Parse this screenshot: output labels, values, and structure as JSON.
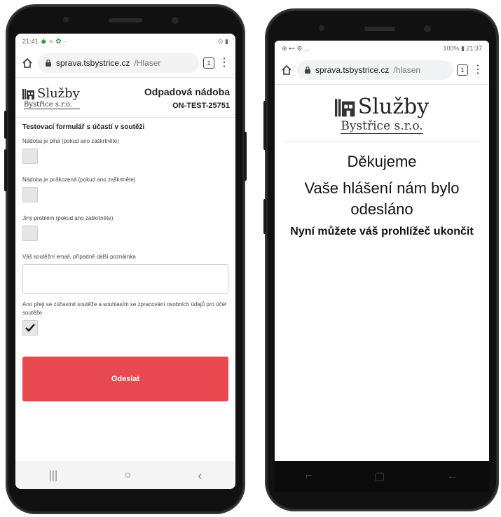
{
  "left": {
    "status": {
      "time": "21:41",
      "right_icons": "⊙ ▮"
    },
    "url": {
      "domain": "sprava.tsbystrice.cz",
      "path": "/Hlaser",
      "tab_count": "1"
    },
    "logo": {
      "name": "Služby",
      "sub": "Bystřice s.r.o."
    },
    "header": {
      "title": "Odpadová nádoba",
      "code": "ON-TEST-25751"
    },
    "form": {
      "title": "Testovací formulář s účastí v soutěži",
      "fields": [
        {
          "label": "Nádoba je plná (pokud ano zaškrtněte)"
        },
        {
          "label": "Nádoba je poškozená (pokud ano zaškrtněte)"
        },
        {
          "label": "Jiný problém (pokud ano zaškrtněte)"
        }
      ],
      "email_label": "Váš soutěžní email, případně další poznámka",
      "consent_label": "Ano přeji se zúčastnit soutěže a souhlasím se zpracování osobních údajů pro účel soutěže",
      "consent_checked": true,
      "submit_label": "Odeslat"
    },
    "nav": {
      "recents": "|||",
      "home": "○",
      "back": "‹"
    }
  },
  "right": {
    "status": {
      "left_icons": "⊕ ⊷ ⚙ ...",
      "right_text": "100% ▮ 21:37"
    },
    "url": {
      "domain": "sprava.tsbystrice.cz",
      "path": "/hlasen",
      "tab_count": "1"
    },
    "logo": {
      "name": "Služby",
      "sub": "Bystřice s.r.o."
    },
    "thanks": {
      "heading": "Děkujeme",
      "message": "Vaše hlášení nám bylo odesláno",
      "note": "Nyní můžete váš prohlížeč ukončit"
    },
    "nav": {
      "recents": "⌐",
      "home": "▢",
      "back": "←"
    }
  },
  "colors": {
    "accent": "#e8484f",
    "secure": "#202124"
  }
}
